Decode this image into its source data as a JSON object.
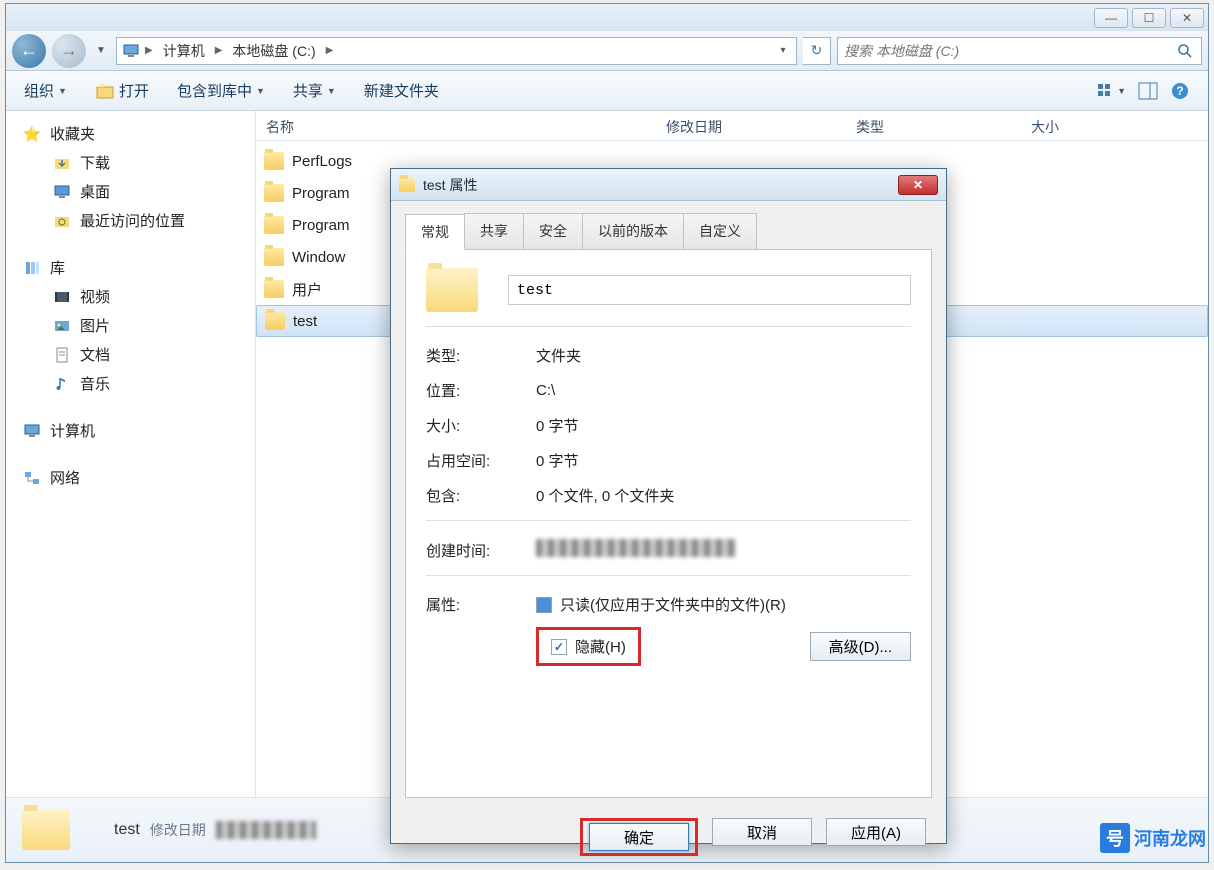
{
  "titlebar": {
    "min": "—",
    "max": "☐",
    "close": "✕"
  },
  "breadcrumb": {
    "computer": "计算机",
    "drive": "本地磁盘 (C:)"
  },
  "search": {
    "placeholder": "搜索 本地磁盘 (C:)"
  },
  "toolbar": {
    "organize": "组织",
    "open": "打开",
    "include": "包含到库中",
    "share": "共享",
    "newfolder": "新建文件夹"
  },
  "sidebar": {
    "favorites": "收藏夹",
    "downloads": "下载",
    "desktop": "桌面",
    "recent": "最近访问的位置",
    "libraries": "库",
    "videos": "视频",
    "pictures": "图片",
    "documents": "文档",
    "music": "音乐",
    "computer": "计算机",
    "network": "网络"
  },
  "columns": {
    "name": "名称",
    "date": "修改日期",
    "type": "类型",
    "size": "大小"
  },
  "folders": [
    "PerfLogs",
    "Program",
    "Program",
    "Window",
    "用户",
    "test"
  ],
  "details": {
    "name": "test",
    "datelabel": "修改日期"
  },
  "dialog": {
    "title": "test 属性",
    "tabs": [
      "常规",
      "共享",
      "安全",
      "以前的版本",
      "自定义"
    ],
    "foldername": "test",
    "type_l": "类型:",
    "type_v": "文件夹",
    "loc_l": "位置:",
    "loc_v": "C:\\",
    "size_l": "大小:",
    "size_v": "0 字节",
    "disk_l": "占用空间:",
    "disk_v": "0 字节",
    "contains_l": "包含:",
    "contains_v": "0 个文件, 0 个文件夹",
    "created_l": "创建时间:",
    "attr_l": "属性:",
    "readonly": "只读(仅应用于文件夹中的文件)(R)",
    "hidden": "隐藏(H)",
    "advanced": "高级(D)...",
    "ok": "确定",
    "cancel": "取消",
    "apply": "应用(A)"
  },
  "watermark": "河南龙网"
}
